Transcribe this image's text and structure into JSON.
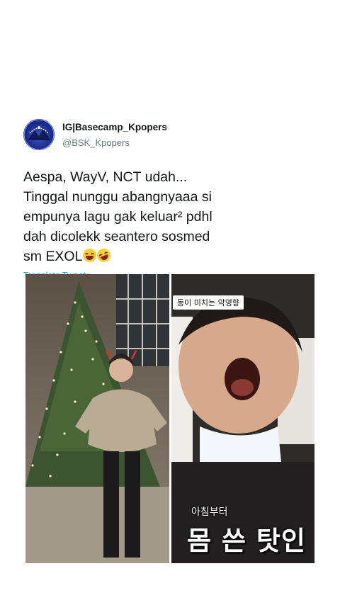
{
  "tweet": {
    "display_name": "IG|Basecamp_Kpopers",
    "handle": "@BSK_Kpopers",
    "text_lines": [
      "Aespa, WayV, NCT udah...",
      "Tinggal nunggu abangnyaaa si",
      "empunya lagu gak keluar² pdhl",
      "dah dicolekk seantero sosmed",
      "sm EXOL"
    ],
    "emojis": [
      "grinning-sweat-emoji",
      "rolling-laughing-emoji"
    ],
    "translate_label": "Translate Tweet"
  },
  "media": {
    "left_image": "person-dancing-by-christmas-tree",
    "right_image": "person-yawning-in-car",
    "caption_top": "동이 미치는 악영향",
    "caption_small": "아침부터",
    "caption_big": "몸 쓴 탓인"
  },
  "colors": {
    "link": "#1d9bf0",
    "text": "#14171a",
    "muted": "#657786"
  }
}
